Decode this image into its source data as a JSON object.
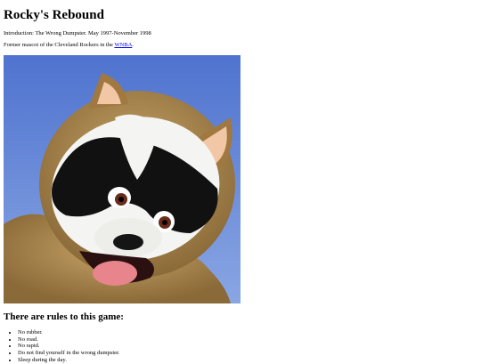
{
  "title": "Rocky's Rebound",
  "intro": "Introduction: The Wrong Dumpster. May 1997-November 1998",
  "former_prefix": "Former mascot of the Cleveland Rockers in the ",
  "former_link": "WNBA",
  "former_suffix": ".",
  "photo_icon": "raccoon-mascot-photo",
  "rules_heading": "There are rules to this game:",
  "rules": [
    "No rubber.",
    "No road.",
    "No rapid.",
    "Do not find yourself in the wrong dumpster.",
    "Sleep during the day."
  ]
}
